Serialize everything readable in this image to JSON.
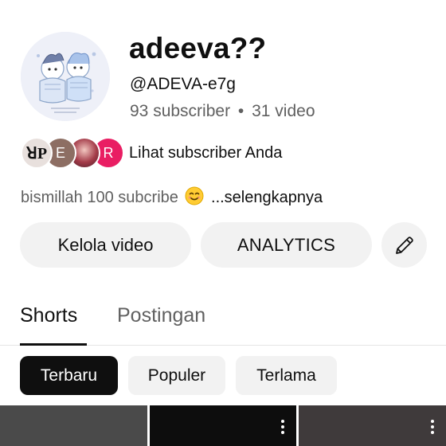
{
  "channel": {
    "name": "adeeva??",
    "handle": "@ADEVA-e7g",
    "subscribers": "93 subscriber",
    "separator": "•",
    "videos": "31 video",
    "avatar_icon": "anime-character-avatar"
  },
  "subscribers_row": {
    "avatars": [
      "ꓤP",
      "E",
      "",
      "R"
    ],
    "label": "Lihat subscriber Anda"
  },
  "description": {
    "text": "bismillah 100 subcribe",
    "emoji_icon": "smiling-face-emoji",
    "more": "...selengkapnya"
  },
  "actions": {
    "manage_label": "Kelola video",
    "analytics_label": "ANALYTICS",
    "edit_icon": "pencil-icon"
  },
  "tabs": {
    "shorts": "Shorts",
    "posts": "Postingan"
  },
  "filters": {
    "newest": "Terbaru",
    "popular": "Populer",
    "oldest": "Terlama"
  },
  "colors": {
    "pill_bg": "#f2f2f2",
    "selected_chip_bg": "#0f0f0f",
    "secondary_text": "#606060"
  }
}
